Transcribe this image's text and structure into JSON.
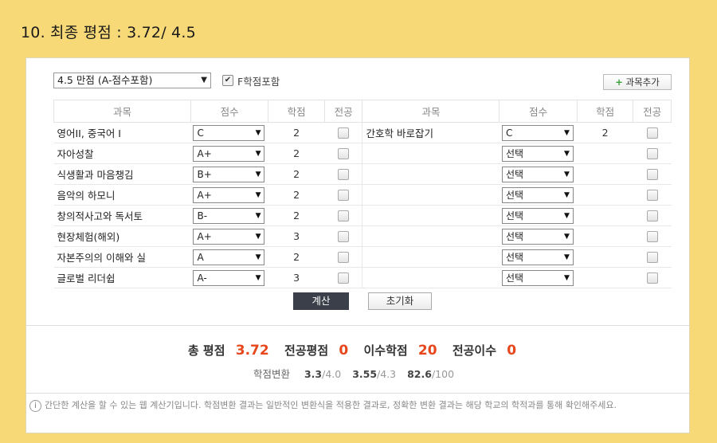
{
  "slide_title": "10. 최종 평점 : 3.72/ 4.5",
  "controls": {
    "scale_select": "4.5 만점 (A-점수포함)",
    "f_include_label": "F학점포함",
    "f_include_checked": true,
    "add_course_label": "과목추가"
  },
  "headers": [
    "과목",
    "점수",
    "학점",
    "전공",
    "과목",
    "점수",
    "학점",
    "전공"
  ],
  "rows": [
    {
      "left": {
        "subject": "영어II, 중국어 I",
        "grade": "C",
        "credits": "2"
      },
      "right": {
        "subject": "간호학 바로잡기",
        "grade": "C",
        "credits": "2"
      }
    },
    {
      "left": {
        "subject": "자아성찰",
        "grade": "A+",
        "credits": "2"
      },
      "right": {
        "subject": "",
        "grade": "선택",
        "credits": ""
      }
    },
    {
      "left": {
        "subject": "식생활과 마음챙김",
        "grade": "B+",
        "credits": "2"
      },
      "right": {
        "subject": "",
        "grade": "선택",
        "credits": ""
      }
    },
    {
      "left": {
        "subject": "음악의 하모니",
        "grade": "A+",
        "credits": "2"
      },
      "right": {
        "subject": "",
        "grade": "선택",
        "credits": ""
      }
    },
    {
      "left": {
        "subject": "창의적사고와 독서토",
        "grade": "B-",
        "credits": "2"
      },
      "right": {
        "subject": "",
        "grade": "선택",
        "credits": ""
      }
    },
    {
      "left": {
        "subject": "현장체험(해외)",
        "grade": "A+",
        "credits": "3"
      },
      "right": {
        "subject": "",
        "grade": "선택",
        "credits": ""
      }
    },
    {
      "left": {
        "subject": "자본주의의 이해와 실",
        "grade": "A",
        "credits": "2"
      },
      "right": {
        "subject": "",
        "grade": "선택",
        "credits": ""
      }
    },
    {
      "left": {
        "subject": "글로벌 리더쉽",
        "grade": "A-",
        "credits": "3"
      },
      "right": {
        "subject": "",
        "grade": "선택",
        "credits": ""
      }
    }
  ],
  "buttons": {
    "calculate": "계산",
    "reset": "초기화"
  },
  "summary": {
    "gpa_label": "총 평점",
    "gpa_value": "3.72",
    "major_gpa_label": "전공평점",
    "major_gpa_value": "0",
    "credits_label": "이수학점",
    "credits_value": "20",
    "major_credits_label": "전공이수",
    "major_credits_value": "0"
  },
  "conversion": {
    "label": "학점변환",
    "v1": "3.3",
    "d1": "/4.0",
    "v2": "3.55",
    "d2": "/4.3",
    "v3": "82.6",
    "d3": "/100"
  },
  "notice": "간단한 계산을 할 수 있는 웹 계산기입니다. 학점변환 결과는 일반적인 변환식을 적용한 결과로, 정확한 변환 결과는 해당 학교의 학적과를 통해 확인해주세요.",
  "colors": {
    "background": "#f7d978",
    "accent": "#e8461c",
    "calc_button": "#3b3f4a"
  },
  "icons": {
    "dropdown": "caret-down-icon",
    "add": "plus-icon",
    "info": "info-icon"
  }
}
